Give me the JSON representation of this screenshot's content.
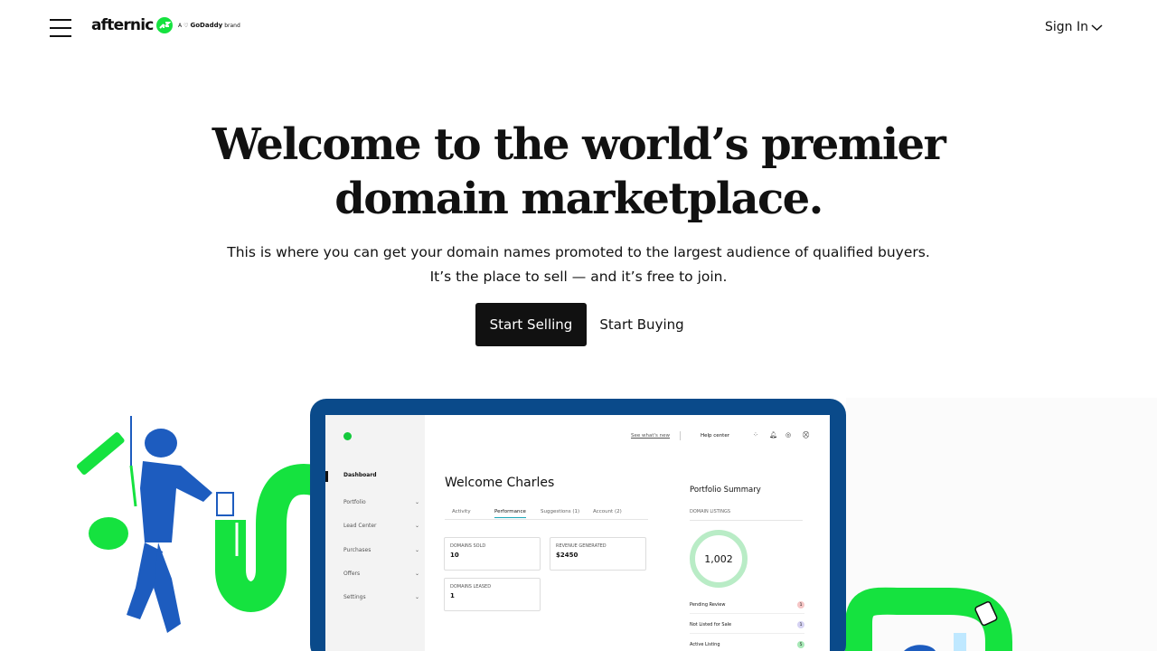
{
  "header": {
    "logo_text": "afternic",
    "brand_tag_prefix": "A",
    "brand_tag_name": "GoDaddy",
    "brand_tag_suffix": "brand",
    "sign_in": "Sign In"
  },
  "hero": {
    "title_line1": "Welcome to the world’s premier",
    "title_line2": "domain marketplace.",
    "subtitle_line1": "This is where you can get your domain names promoted to the largest audience of qualified buyers.",
    "subtitle_line2": "It’s the place to sell — and it’s free to join.",
    "start_selling": "Start Selling",
    "start_buying": "Start Buying"
  },
  "dashboard": {
    "see_whats_new": "See what's new",
    "help_center": "Help center",
    "sidebar": [
      {
        "label": "Dashboard"
      },
      {
        "label": "Portfolio"
      },
      {
        "label": "Lead Center"
      },
      {
        "label": "Purchases"
      },
      {
        "label": "Offers"
      },
      {
        "label": "Settings"
      }
    ],
    "welcome": "Welcome Charles",
    "tabs": [
      "Activity",
      "Performance",
      "Suggestions (1)",
      "Account (2)"
    ],
    "cards": [
      {
        "label": "DOMAINS SOLD",
        "value": "10"
      },
      {
        "label": "REVENUE GENERATED",
        "value": "$2450"
      },
      {
        "label": "DOMAINS LEASED",
        "value": "1"
      }
    ],
    "portfolio_summary": "Portfolio Summary",
    "domain_listings": "DOMAIN LISTINGS",
    "listings_total": "1,002",
    "statuses": [
      {
        "label": "Pending Review",
        "count": "1",
        "color": "#f6c6c6"
      },
      {
        "label": "Not Listed for Sale",
        "count": "1",
        "color": "#d6d3f3"
      },
      {
        "label": "Active Listing",
        "count": "5",
        "color": "#a8e9b7"
      }
    ]
  },
  "colors": {
    "brand_green": "#15e23f",
    "laptop_blue": "#0a4a8a",
    "button_dark": "#111111"
  }
}
